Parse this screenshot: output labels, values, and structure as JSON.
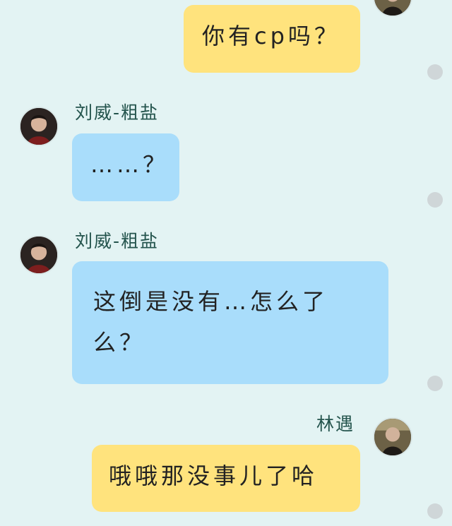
{
  "messages": [
    {
      "direction": "outgoing",
      "text": "你有cp吗？"
    },
    {
      "direction": "incoming",
      "sender": "刘威-粗盐",
      "text": "……？"
    },
    {
      "direction": "incoming",
      "sender": "刘威-粗盐",
      "text": "这倒是没有…怎么了么？"
    },
    {
      "direction": "outgoing",
      "sender": "林遇",
      "text": "哦哦那没事儿了哈"
    }
  ],
  "icons": {
    "status": "status-dot",
    "avatar_other": "avatar-liu-wei",
    "avatar_self": "avatar-lin-yu"
  },
  "colors": {
    "background": "#e3f3f3",
    "outgoing_bubble": "#ffe37d",
    "incoming_bubble": "#a9ddfb",
    "sender_name": "#24544d",
    "status_dot": "#cfd6d8"
  }
}
